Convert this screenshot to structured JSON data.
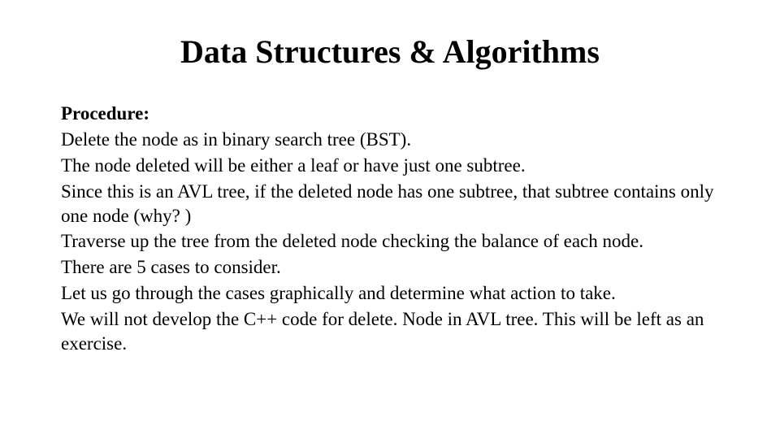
{
  "title": "Data Structures & Algorithms",
  "subheading": "Procedure:",
  "lines": [
    "Delete the node as in binary search tree (BST).",
    "The node deleted will be either a leaf or have just one subtree.",
    "Since this is an AVL tree, if the deleted node has one subtree, that subtree contains only one node (why? )",
    "Traverse up the tree from the deleted node checking the balance of each node.",
    "There are 5 cases to consider.",
    "Let us go through the cases graphically and determine what action to take.",
    "We will not develop the C++ code for delete. Node in AVL tree. This will be left as an exercise."
  ]
}
